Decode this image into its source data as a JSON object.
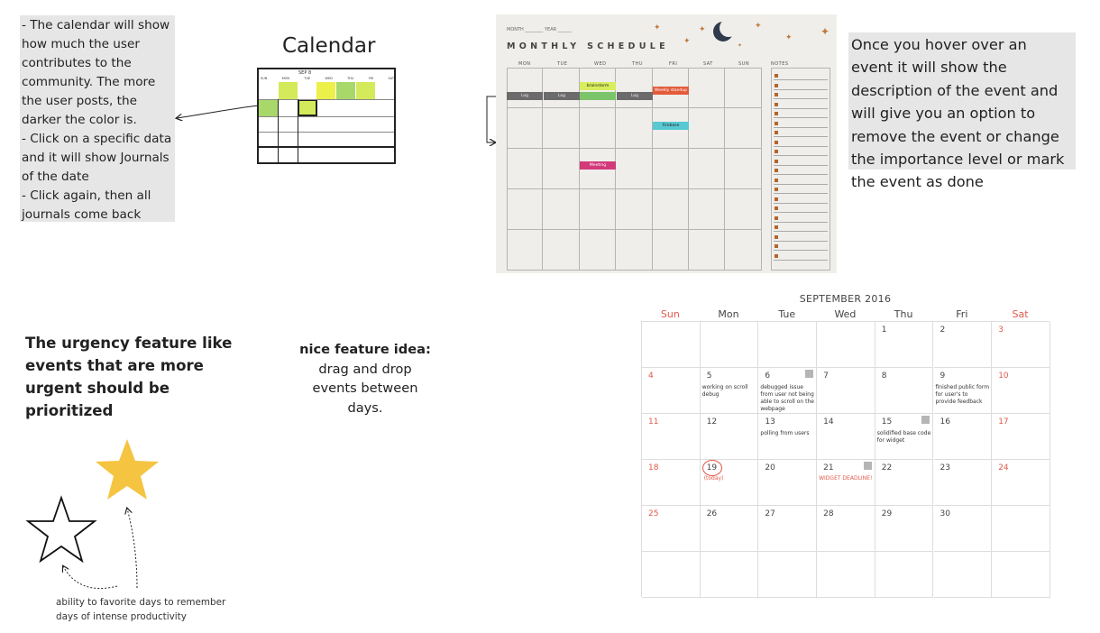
{
  "notes": {
    "calendar_note": "- The calendar will show how much the user contributes to the community. The more the user posts, the darker the color is.\n- Click on a specific data and it will show Journals of the date\n- Click again, then all journals come back",
    "hover_note": "Once you hover over an event it will show the description of the event and will give you an option to remove the event or change the importance level or mark the event as done",
    "urgency": "The urgency feature like events that are more urgent should be prioritized",
    "dragdrop_title": "nice feature idea:",
    "dragdrop_body": "drag and drop events between days.",
    "favorite": "ability to favorite days to remember days of intense productivity"
  },
  "mini_calendar": {
    "title": "Calendar",
    "month": "SEP 8",
    "headers": [
      "SUN",
      "MON",
      "TUE",
      "WED",
      "THU",
      "FRI",
      "SAT"
    ],
    "colors": {
      "light": "#d4ea5a",
      "mid": "#a8d86a",
      "yellow": "#eef04a"
    }
  },
  "monthly_schedule": {
    "month_label": "MONTH",
    "year_label": "YEAR",
    "title": "MONTHLY SCHEDULE",
    "days": [
      "MON",
      "TUE",
      "WED",
      "THU",
      "FRI",
      "SAT",
      "SUN"
    ],
    "notes_label": "NOTES",
    "events": [
      {
        "label": "brainstorm",
        "color": "#d8ee5c"
      },
      {
        "label": "Weekly standup",
        "color": "#e35b3b"
      },
      {
        "label": "Log",
        "color": "#6b6b6b"
      },
      {
        "label": "Log",
        "color": "#6b6b6b"
      },
      {
        "label": "Log",
        "color": "#6b6b6b"
      },
      {
        "label": "",
        "color": "#7cc46a"
      },
      {
        "label": "Firebase",
        "color": "#58c8d2"
      },
      {
        "label": "Meeting",
        "color": "#d23a7a"
      }
    ]
  },
  "september": {
    "title": "SEPTEMBER 2016",
    "weekdays": [
      "Sun",
      "Mon",
      "Tue",
      "Wed",
      "Thu",
      "Fri",
      "Sat"
    ],
    "cells": [
      {
        "num": "",
        "text": ""
      },
      {
        "num": "",
        "text": ""
      },
      {
        "num": "",
        "text": ""
      },
      {
        "num": "",
        "text": ""
      },
      {
        "num": "1",
        "text": ""
      },
      {
        "num": "2",
        "text": ""
      },
      {
        "num": "3",
        "text": ""
      },
      {
        "num": "4",
        "text": ""
      },
      {
        "num": "5",
        "text": "working on scroll debug"
      },
      {
        "num": "6",
        "text": "debugged issue from user not being able to scroll on the webpage",
        "flag": true
      },
      {
        "num": "7",
        "text": ""
      },
      {
        "num": "8",
        "text": ""
      },
      {
        "num": "9",
        "text": "finished public form for user's to provide feedback"
      },
      {
        "num": "10",
        "text": ""
      },
      {
        "num": "11",
        "text": ""
      },
      {
        "num": "12",
        "text": ""
      },
      {
        "num": "13",
        "text": "polling from users"
      },
      {
        "num": "14",
        "text": ""
      },
      {
        "num": "15",
        "text": "solidified base code for widget",
        "flag": true
      },
      {
        "num": "16",
        "text": ""
      },
      {
        "num": "17",
        "text": ""
      },
      {
        "num": "18",
        "text": ""
      },
      {
        "num": "19",
        "text": "",
        "today": "(today)"
      },
      {
        "num": "20",
        "text": ""
      },
      {
        "num": "21",
        "text": "WIDGET DEADLINE!",
        "flag": true,
        "red": true
      },
      {
        "num": "22",
        "text": ""
      },
      {
        "num": "23",
        "text": ""
      },
      {
        "num": "24",
        "text": ""
      },
      {
        "num": "25",
        "text": ""
      },
      {
        "num": "26",
        "text": ""
      },
      {
        "num": "27",
        "text": ""
      },
      {
        "num": "28",
        "text": ""
      },
      {
        "num": "29",
        "text": ""
      },
      {
        "num": "30",
        "text": ""
      },
      {
        "num": "",
        "text": ""
      },
      {
        "num": "",
        "text": ""
      },
      {
        "num": "",
        "text": ""
      },
      {
        "num": "",
        "text": ""
      },
      {
        "num": "",
        "text": ""
      },
      {
        "num": "",
        "text": ""
      },
      {
        "num": "",
        "text": ""
      },
      {
        "num": "",
        "text": ""
      }
    ],
    "weekend_color": "#e05a4a"
  },
  "stars": {
    "filled_color": "#f5c440",
    "icon": "star-icon"
  }
}
